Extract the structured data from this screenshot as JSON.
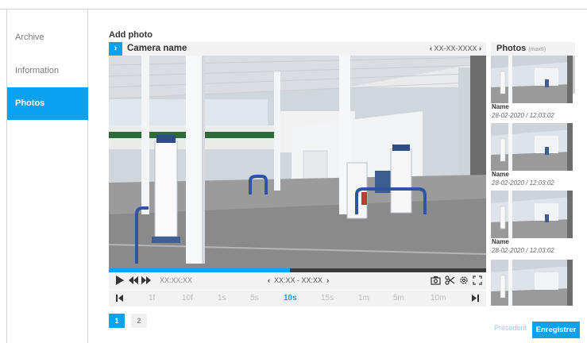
{
  "sidebar": {
    "items": [
      {
        "label": "Archive",
        "active": false
      },
      {
        "label": "Information",
        "active": false
      },
      {
        "label": "Photos",
        "active": true
      }
    ]
  },
  "page_title": "Add photo",
  "camera": {
    "name": "Camera name",
    "date": "XX-XX-XXXX"
  },
  "player": {
    "progress": 0.48,
    "timecode": "XX:XX:XX",
    "range": "XX:XX - XX:XX",
    "speeds": [
      "1f",
      "10f",
      "1s",
      "5s",
      "10s",
      "15s",
      "1m",
      "5m",
      "10m"
    ],
    "active_speed": "10s"
  },
  "photos": {
    "title": "Photos",
    "max_label": "(max8)",
    "items": [
      {
        "name": "Name",
        "date": "28-02-2020 / 12:03:02"
      },
      {
        "name": "Name",
        "date": "28-02-2020 / 12:03:02"
      },
      {
        "name": "Name",
        "date": "28-02-2020 / 12:03:02"
      }
    ]
  },
  "pagination": {
    "pages": [
      "1",
      "2"
    ],
    "current": "1"
  },
  "footer": {
    "prev_label": "Précédent",
    "save_label": "Enregistrer"
  },
  "colors": {
    "accent": "#0aa1f0",
    "panel": "#f2f2f2"
  },
  "icons": [
    "chevron-right-icon",
    "chevron-left-icon",
    "play-icon",
    "rewind-icon",
    "fast-forward-icon",
    "camera-icon",
    "scissors-icon",
    "settings-icon",
    "fullscreen-icon",
    "step-back-icon",
    "step-forward-icon"
  ]
}
